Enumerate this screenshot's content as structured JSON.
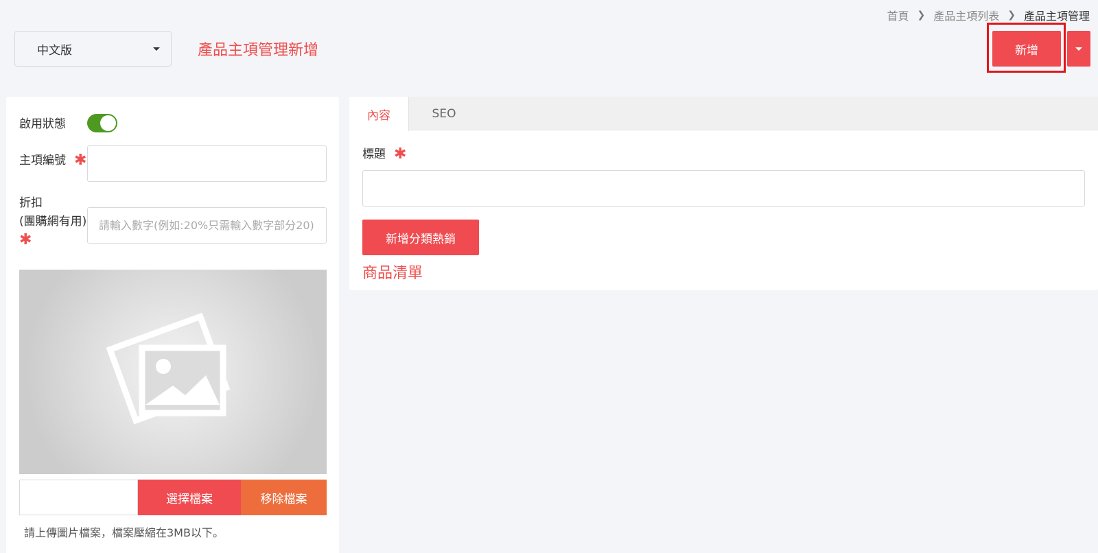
{
  "breadcrumb": {
    "items": [
      "首頁",
      "產品主項列表",
      "產品主項管理"
    ]
  },
  "language_select": {
    "value": "中文版"
  },
  "page_title": "產品主項管理新增",
  "header_actions": {
    "add_label": "新增"
  },
  "form_left": {
    "status_label": "啟用狀態",
    "status_enabled": true,
    "item_no_label": "主項編號",
    "item_no_value": "",
    "discount_label_line1": "折扣",
    "discount_label_line2": "(團購網有用)",
    "discount_placeholder": "請輸入數字(例如:20%只需輸入數字部分20)",
    "discount_value": "",
    "required_mark": "✱",
    "choose_file_label": "選擇檔案",
    "remove_file_label": "移除檔案",
    "upload_hint": "請上傳圖片檔案，檔案壓縮在3MB以下。"
  },
  "tabs": [
    {
      "label": "內容",
      "active": true
    },
    {
      "label": "SEO",
      "active": false
    }
  ],
  "content": {
    "title_label": "標題",
    "title_value": "",
    "add_hot_button": "新增分類熱銷",
    "product_list_heading": "商品清單"
  },
  "colors": {
    "accent": "#ef4b50",
    "remove_button": "#ed6e3c",
    "toggle_on": "#4e9a21",
    "highlight_box": "#e0161d"
  }
}
